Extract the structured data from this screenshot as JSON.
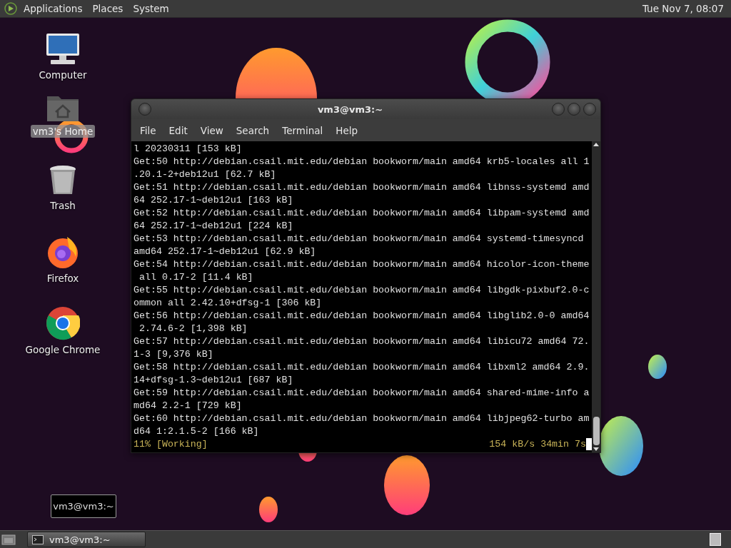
{
  "top_panel": {
    "menus": [
      "Applications",
      "Places",
      "System"
    ],
    "clock": "Tue Nov 7, 08:07"
  },
  "desktop_icons": [
    {
      "label": "Computer",
      "kind": "computer",
      "selected": false
    },
    {
      "label": "vm3's Home",
      "kind": "home",
      "selected": true
    },
    {
      "label": "Trash",
      "kind": "trash",
      "selected": false
    },
    {
      "label": "Firefox",
      "kind": "firefox",
      "selected": false
    },
    {
      "label": "Google Chrome",
      "kind": "chrome",
      "selected": false
    }
  ],
  "terminal": {
    "title": "vm3@vm3:~",
    "menu": [
      "File",
      "Edit",
      "View",
      "Search",
      "Terminal",
      "Help"
    ],
    "lines": [
      "l 20230311 [153 kB]",
      "Get:50 http://debian.csail.mit.edu/debian bookworm/main amd64 krb5-locales all 1",
      ".20.1-2+deb12u1 [62.7 kB]",
      "Get:51 http://debian.csail.mit.edu/debian bookworm/main amd64 libnss-systemd amd",
      "64 252.17-1~deb12u1 [163 kB]",
      "Get:52 http://debian.csail.mit.edu/debian bookworm/main amd64 libpam-systemd amd",
      "64 252.17-1~deb12u1 [224 kB]",
      "Get:53 http://debian.csail.mit.edu/debian bookworm/main amd64 systemd-timesyncd ",
      "amd64 252.17-1~deb12u1 [62.9 kB]",
      "Get:54 http://debian.csail.mit.edu/debian bookworm/main amd64 hicolor-icon-theme",
      " all 0.17-2 [11.4 kB]",
      "Get:55 http://debian.csail.mit.edu/debian bookworm/main amd64 libgdk-pixbuf2.0-c",
      "ommon all 2.42.10+dfsg-1 [306 kB]",
      "Get:56 http://debian.csail.mit.edu/debian bookworm/main amd64 libglib2.0-0 amd64",
      " 2.74.6-2 [1,398 kB]",
      "Get:57 http://debian.csail.mit.edu/debian bookworm/main amd64 libicu72 amd64 72.",
      "1-3 [9,376 kB]",
      "Get:58 http://debian.csail.mit.edu/debian bookworm/main amd64 libxml2 amd64 2.9.",
      "14+dfsg-1.3~deb12u1 [687 kB]",
      "Get:59 http://debian.csail.mit.edu/debian bookworm/main amd64 shared-mime-info a",
      "md64 2.2-1 [729 kB]",
      "Get:60 http://debian.csail.mit.edu/debian bookworm/main amd64 libjpeg62-turbo am",
      "d64 1:2.1.5-2 [166 kB]"
    ],
    "status": {
      "progress": "11% [Working]",
      "rate": "154 kB/s 34min 7s"
    }
  },
  "tooltip": "vm3@vm3:~",
  "taskbar": {
    "tasks": [
      {
        "label": "vm3@vm3:~",
        "selected": true
      }
    ]
  }
}
